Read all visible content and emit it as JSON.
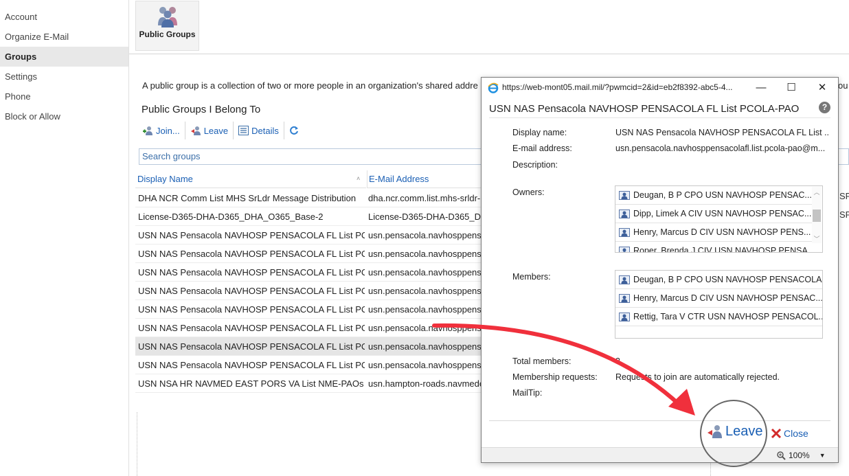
{
  "nav": {
    "items": [
      {
        "label": "Account"
      },
      {
        "label": "Organize E-Mail"
      },
      {
        "label": "Groups"
      },
      {
        "label": "Settings"
      },
      {
        "label": "Phone"
      },
      {
        "label": "Block or Allow"
      }
    ]
  },
  "ribbon": {
    "public_groups_label": "Public Groups"
  },
  "page": {
    "description": "A public group is a collection of two or more people in an organization's shared addre",
    "description_tail": "ou",
    "section_title": "Public Groups I Belong To"
  },
  "toolbar": {
    "join_label": "Join...",
    "leave_label": "Leave",
    "details_label": "Details"
  },
  "search": {
    "placeholder": "Search groups"
  },
  "grid": {
    "col_display_name": "Display Name",
    "col_email": "E-Mail Address",
    "rows": [
      {
        "name": "DHA NCR Comm List MHS SrLdr Message Distribution",
        "email": "dha.ncr.comm.list.mhs-srldr-m"
      },
      {
        "name": "License-D365-DHA-D365_DHA_O365_Base-2",
        "email": "License-D365-DHA-D365_DHA"
      },
      {
        "name": "USN NAS Pensacola NAVHOSP PENSACOLA FL List PCO...",
        "email": "usn.pensacola.navhosppensac"
      },
      {
        "name": "USN NAS Pensacola NAVHOSP PENSACOLA FL List PCO...",
        "email": "usn.pensacola.navhosppensac"
      },
      {
        "name": "USN NAS Pensacola NAVHOSP PENSACOLA FL List PCO...",
        "email": "usn.pensacola.navhosppensac"
      },
      {
        "name": "USN NAS Pensacola NAVHOSP PENSACOLA FL List PCO...",
        "email": "usn.pensacola.navhosppensac"
      },
      {
        "name": "USN NAS Pensacola NAVHOSP PENSACOLA FL List PCO...",
        "email": "usn.pensacola.navhosppensac"
      },
      {
        "name": "USN NAS Pensacola NAVHOSP PENSACOLA FL List PCO...",
        "email": "usn.pensacola.navhosppensac"
      },
      {
        "name": "USN NAS Pensacola NAVHOSP PENSACOLA FL List PCO...",
        "email": "usn.pensacola.navhosppensac"
      },
      {
        "name": "USN NAS Pensacola NAVHOSP PENSACOLA FL List PCO...",
        "email": "usn.pensacola.navhosppensac"
      },
      {
        "name": "USN NSA HR NAVMED EAST PORS VA List NME-PAOs",
        "email": "usn.hampton-roads.navmede"
      }
    ],
    "behind_row1": "SP",
    "behind_row2": "SP"
  },
  "popup": {
    "url": "https://web-mont05.mail.mil/?pwmcid=2&id=eb2f8392-abc5-4...",
    "minimize": "—",
    "maximize": "☐",
    "close": "✕",
    "heading": "USN NAS Pensacola NAVHOSP PENSACOLA FL List PCOLA-PAO",
    "help": "?",
    "labels": {
      "display_name": "Display name:",
      "email": "E-mail address:",
      "description": "Description:",
      "owners": "Owners:",
      "members": "Members:",
      "total_members": "Total members:",
      "membership_requests": "Membership requests:",
      "mailtip": "MailTip:"
    },
    "values": {
      "display_name": "USN NAS Pensacola NAVHOSP PENSACOLA FL List ...",
      "email": "usn.pensacola.navhosppensacolafl.list.pcola-pao@m...",
      "total_members": "3",
      "membership_requests": "Requests to join are automatically rejected."
    },
    "owners": [
      "Deugan, B P CPO USN NAVHOSP PENSAC...",
      "Dipp, Limek A CIV USN NAVHOSP PENSAC...",
      "Henry, Marcus D CIV USN NAVHOSP PENS...",
      "Roper, Brenda J CIV USN NAVHOSP PENSA..."
    ],
    "members": [
      "Deugan, B P CPO USN NAVHOSP PENSACOLA...",
      "Henry, Marcus D CIV USN NAVHOSP PENSAC...",
      "Rettig, Tara V CTR USN NAVHOSP PENSACOL..."
    ],
    "leave_label": "Leave",
    "close_label": "Close",
    "zoom": "100%"
  },
  "colors": {
    "accent": "#1a5fb4",
    "arrow": "#f0303c"
  }
}
